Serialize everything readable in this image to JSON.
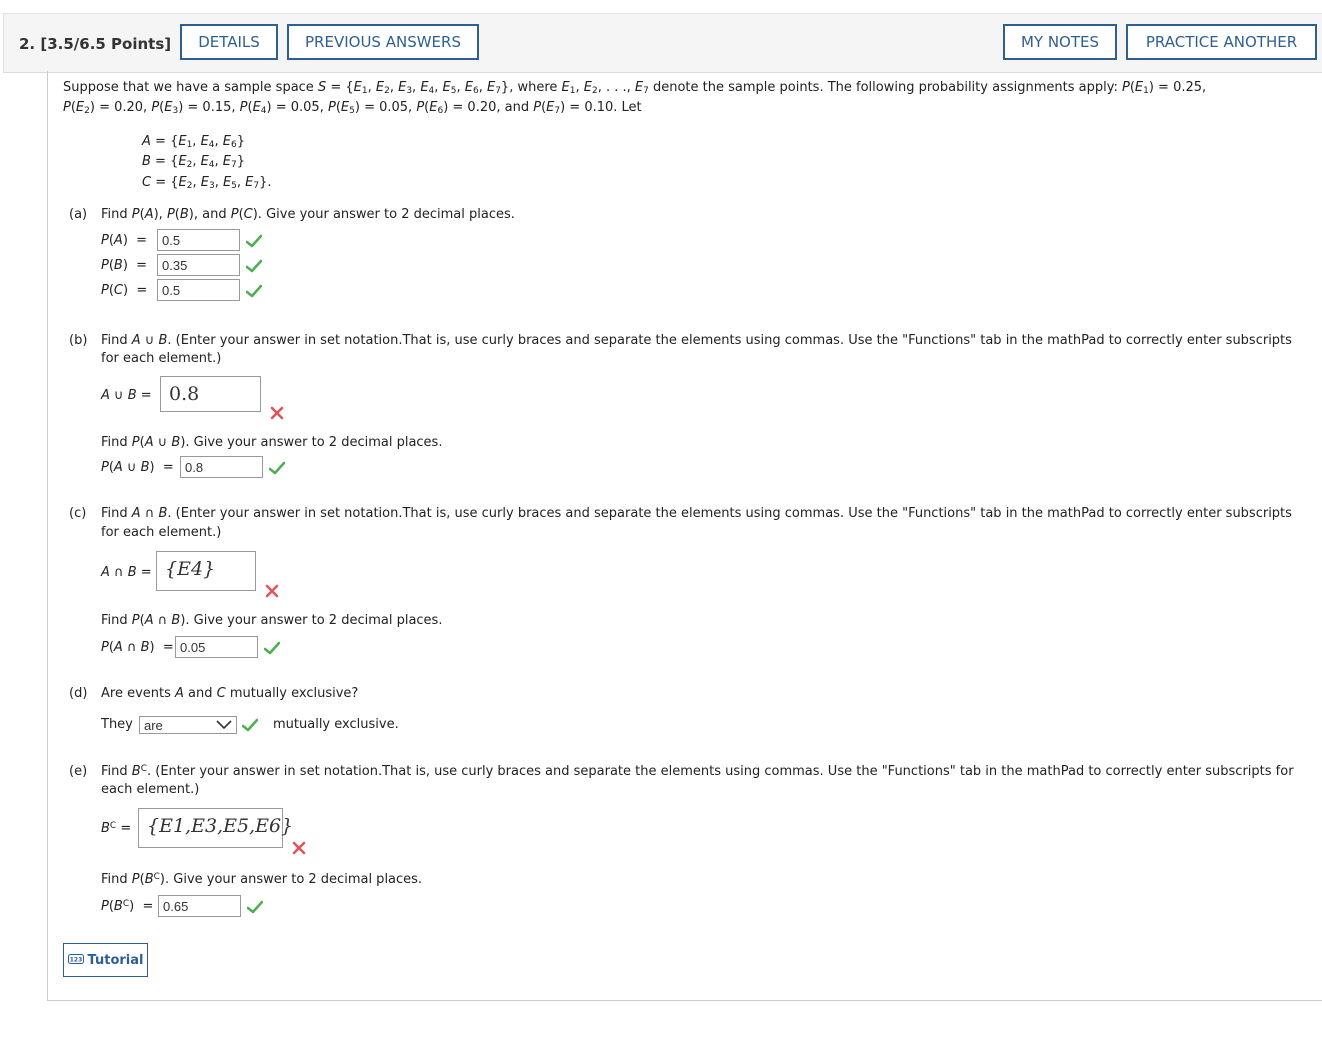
{
  "header": {
    "question_label": "2. [3.5/6.5 Points]",
    "details": "DETAILS",
    "previous_answers": "PREVIOUS ANSWERS",
    "my_notes": "MY NOTES",
    "practice_another": "PRACTICE ANOTHER"
  },
  "labels": {
    "part_a": "(a)",
    "part_b": "(b)",
    "part_c": "(c)",
    "part_d": "(d)",
    "part_e": "(e)",
    "d_prompt": "Are events A and C mutually exclusive?",
    "d_they": "They",
    "d_tail": "mutually exclusive.",
    "tutorial": "Tutorial"
  },
  "answers": {
    "pa": "0.5",
    "pb": "0.35",
    "pc": "0.5",
    "a_union_b": "0.8",
    "p_a_union_b": "0.8",
    "a_inter_b": "{E4}",
    "p_a_inter_b": "0.05",
    "d_select": "are",
    "b_complement": "{E1,E3,E5,E6}",
    "p_b_complement": "0.65"
  },
  "colors": {
    "accent": "#2e5f93",
    "correct": "#4caf50",
    "incorrect": "#e05555"
  },
  "icons": {
    "correct": "check-icon",
    "incorrect": "cross-icon",
    "select": "chevron-down-icon",
    "tutorial": "tutorial-icon"
  }
}
